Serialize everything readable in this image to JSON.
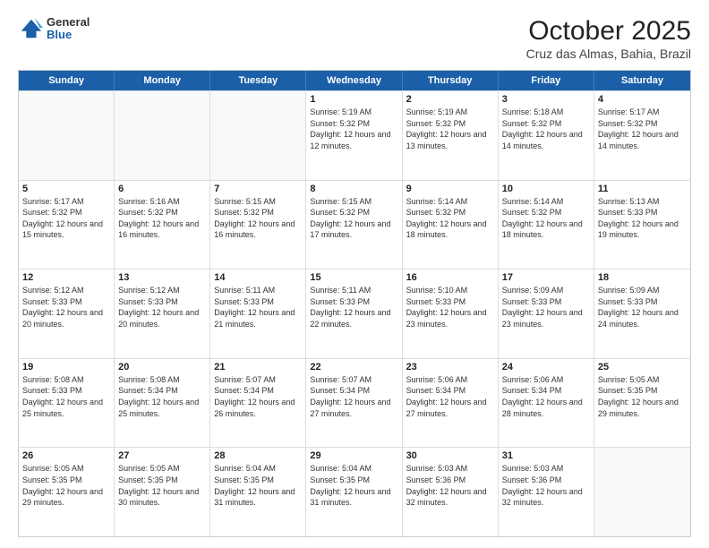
{
  "header": {
    "logo_general": "General",
    "logo_blue": "Blue",
    "title": "October 2025",
    "subtitle": "Cruz das Almas, Bahia, Brazil"
  },
  "days": [
    "Sunday",
    "Monday",
    "Tuesday",
    "Wednesday",
    "Thursday",
    "Friday",
    "Saturday"
  ],
  "weeks": [
    [
      {
        "day": "",
        "sunrise": "",
        "sunset": "",
        "daylight": ""
      },
      {
        "day": "",
        "sunrise": "",
        "sunset": "",
        "daylight": ""
      },
      {
        "day": "",
        "sunrise": "",
        "sunset": "",
        "daylight": ""
      },
      {
        "day": "1",
        "sunrise": "Sunrise: 5:19 AM",
        "sunset": "Sunset: 5:32 PM",
        "daylight": "Daylight: 12 hours and 12 minutes."
      },
      {
        "day": "2",
        "sunrise": "Sunrise: 5:19 AM",
        "sunset": "Sunset: 5:32 PM",
        "daylight": "Daylight: 12 hours and 13 minutes."
      },
      {
        "day": "3",
        "sunrise": "Sunrise: 5:18 AM",
        "sunset": "Sunset: 5:32 PM",
        "daylight": "Daylight: 12 hours and 14 minutes."
      },
      {
        "day": "4",
        "sunrise": "Sunrise: 5:17 AM",
        "sunset": "Sunset: 5:32 PM",
        "daylight": "Daylight: 12 hours and 14 minutes."
      }
    ],
    [
      {
        "day": "5",
        "sunrise": "Sunrise: 5:17 AM",
        "sunset": "Sunset: 5:32 PM",
        "daylight": "Daylight: 12 hours and 15 minutes."
      },
      {
        "day": "6",
        "sunrise": "Sunrise: 5:16 AM",
        "sunset": "Sunset: 5:32 PM",
        "daylight": "Daylight: 12 hours and 16 minutes."
      },
      {
        "day": "7",
        "sunrise": "Sunrise: 5:15 AM",
        "sunset": "Sunset: 5:32 PM",
        "daylight": "Daylight: 12 hours and 16 minutes."
      },
      {
        "day": "8",
        "sunrise": "Sunrise: 5:15 AM",
        "sunset": "Sunset: 5:32 PM",
        "daylight": "Daylight: 12 hours and 17 minutes."
      },
      {
        "day": "9",
        "sunrise": "Sunrise: 5:14 AM",
        "sunset": "Sunset: 5:32 PM",
        "daylight": "Daylight: 12 hours and 18 minutes."
      },
      {
        "day": "10",
        "sunrise": "Sunrise: 5:14 AM",
        "sunset": "Sunset: 5:32 PM",
        "daylight": "Daylight: 12 hours and 18 minutes."
      },
      {
        "day": "11",
        "sunrise": "Sunrise: 5:13 AM",
        "sunset": "Sunset: 5:33 PM",
        "daylight": "Daylight: 12 hours and 19 minutes."
      }
    ],
    [
      {
        "day": "12",
        "sunrise": "Sunrise: 5:12 AM",
        "sunset": "Sunset: 5:33 PM",
        "daylight": "Daylight: 12 hours and 20 minutes."
      },
      {
        "day": "13",
        "sunrise": "Sunrise: 5:12 AM",
        "sunset": "Sunset: 5:33 PM",
        "daylight": "Daylight: 12 hours and 20 minutes."
      },
      {
        "day": "14",
        "sunrise": "Sunrise: 5:11 AM",
        "sunset": "Sunset: 5:33 PM",
        "daylight": "Daylight: 12 hours and 21 minutes."
      },
      {
        "day": "15",
        "sunrise": "Sunrise: 5:11 AM",
        "sunset": "Sunset: 5:33 PM",
        "daylight": "Daylight: 12 hours and 22 minutes."
      },
      {
        "day": "16",
        "sunrise": "Sunrise: 5:10 AM",
        "sunset": "Sunset: 5:33 PM",
        "daylight": "Daylight: 12 hours and 23 minutes."
      },
      {
        "day": "17",
        "sunrise": "Sunrise: 5:09 AM",
        "sunset": "Sunset: 5:33 PM",
        "daylight": "Daylight: 12 hours and 23 minutes."
      },
      {
        "day": "18",
        "sunrise": "Sunrise: 5:09 AM",
        "sunset": "Sunset: 5:33 PM",
        "daylight": "Daylight: 12 hours and 24 minutes."
      }
    ],
    [
      {
        "day": "19",
        "sunrise": "Sunrise: 5:08 AM",
        "sunset": "Sunset: 5:33 PM",
        "daylight": "Daylight: 12 hours and 25 minutes."
      },
      {
        "day": "20",
        "sunrise": "Sunrise: 5:08 AM",
        "sunset": "Sunset: 5:34 PM",
        "daylight": "Daylight: 12 hours and 25 minutes."
      },
      {
        "day": "21",
        "sunrise": "Sunrise: 5:07 AM",
        "sunset": "Sunset: 5:34 PM",
        "daylight": "Daylight: 12 hours and 26 minutes."
      },
      {
        "day": "22",
        "sunrise": "Sunrise: 5:07 AM",
        "sunset": "Sunset: 5:34 PM",
        "daylight": "Daylight: 12 hours and 27 minutes."
      },
      {
        "day": "23",
        "sunrise": "Sunrise: 5:06 AM",
        "sunset": "Sunset: 5:34 PM",
        "daylight": "Daylight: 12 hours and 27 minutes."
      },
      {
        "day": "24",
        "sunrise": "Sunrise: 5:06 AM",
        "sunset": "Sunset: 5:34 PM",
        "daylight": "Daylight: 12 hours and 28 minutes."
      },
      {
        "day": "25",
        "sunrise": "Sunrise: 5:05 AM",
        "sunset": "Sunset: 5:35 PM",
        "daylight": "Daylight: 12 hours and 29 minutes."
      }
    ],
    [
      {
        "day": "26",
        "sunrise": "Sunrise: 5:05 AM",
        "sunset": "Sunset: 5:35 PM",
        "daylight": "Daylight: 12 hours and 29 minutes."
      },
      {
        "day": "27",
        "sunrise": "Sunrise: 5:05 AM",
        "sunset": "Sunset: 5:35 PM",
        "daylight": "Daylight: 12 hours and 30 minutes."
      },
      {
        "day": "28",
        "sunrise": "Sunrise: 5:04 AM",
        "sunset": "Sunset: 5:35 PM",
        "daylight": "Daylight: 12 hours and 31 minutes."
      },
      {
        "day": "29",
        "sunrise": "Sunrise: 5:04 AM",
        "sunset": "Sunset: 5:35 PM",
        "daylight": "Daylight: 12 hours and 31 minutes."
      },
      {
        "day": "30",
        "sunrise": "Sunrise: 5:03 AM",
        "sunset": "Sunset: 5:36 PM",
        "daylight": "Daylight: 12 hours and 32 minutes."
      },
      {
        "day": "31",
        "sunrise": "Sunrise: 5:03 AM",
        "sunset": "Sunset: 5:36 PM",
        "daylight": "Daylight: 12 hours and 32 minutes."
      },
      {
        "day": "",
        "sunrise": "",
        "sunset": "",
        "daylight": ""
      }
    ]
  ]
}
